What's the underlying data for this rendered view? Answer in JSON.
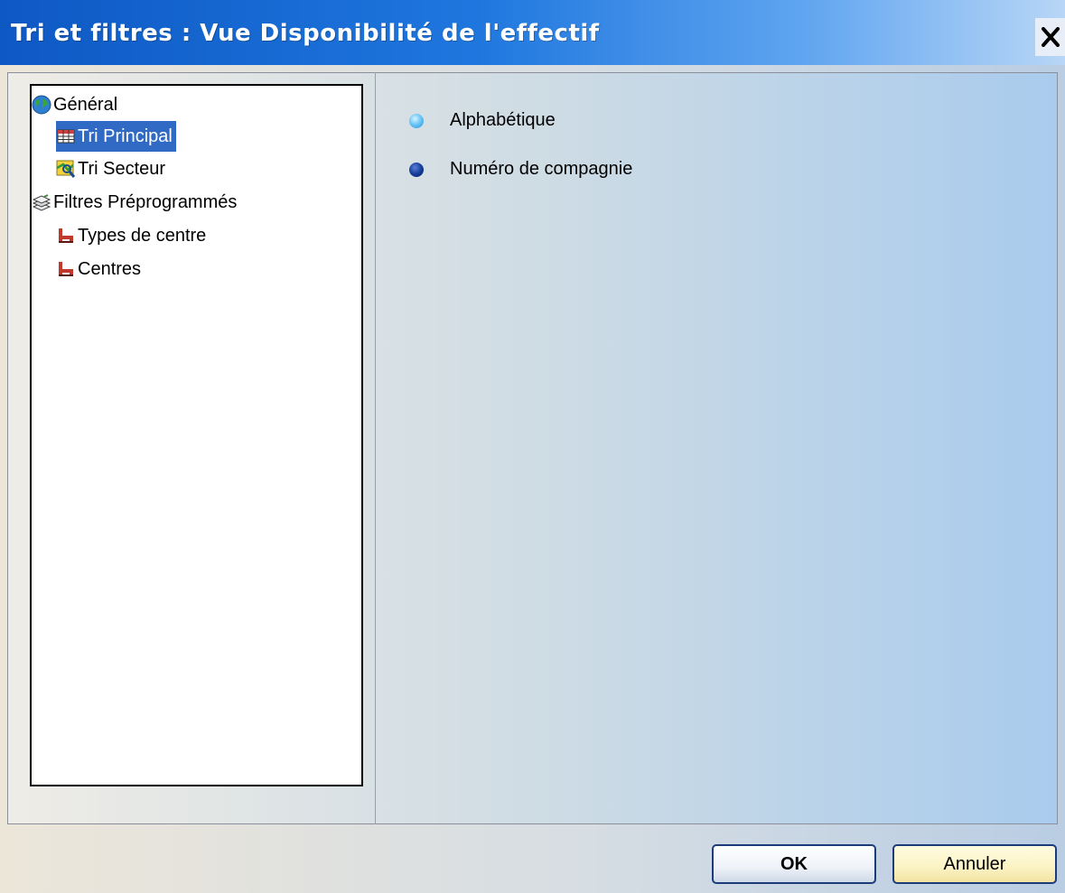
{
  "window": {
    "title": "Tri et filtres : Vue Disponibilité de l'effectif"
  },
  "tree": {
    "items": [
      {
        "label": "Général",
        "icon": "globe-icon"
      },
      {
        "label": "Tri Principal",
        "icon": "grid-table-icon",
        "selected": true
      },
      {
        "label": "Tri Secteur",
        "icon": "map-search-icon"
      },
      {
        "label": "Filtres Préprogrammés",
        "icon": "books-icon"
      },
      {
        "label": "Types de centre",
        "icon": "filter-chair-icon"
      },
      {
        "label": "Centres",
        "icon": "filter-chair-icon"
      }
    ]
  },
  "sort_options": [
    {
      "label": "Alphabétique",
      "selected": true
    },
    {
      "label": "Numéro de compagnie",
      "selected": false
    }
  ],
  "buttons": {
    "ok": "OK",
    "cancel": "Annuler"
  },
  "colors": {
    "title_bar": "#0e58c4",
    "selection": "#316ac5",
    "radio_selected": "#4fb6f3",
    "radio_unselected": "#0b2f8a"
  }
}
